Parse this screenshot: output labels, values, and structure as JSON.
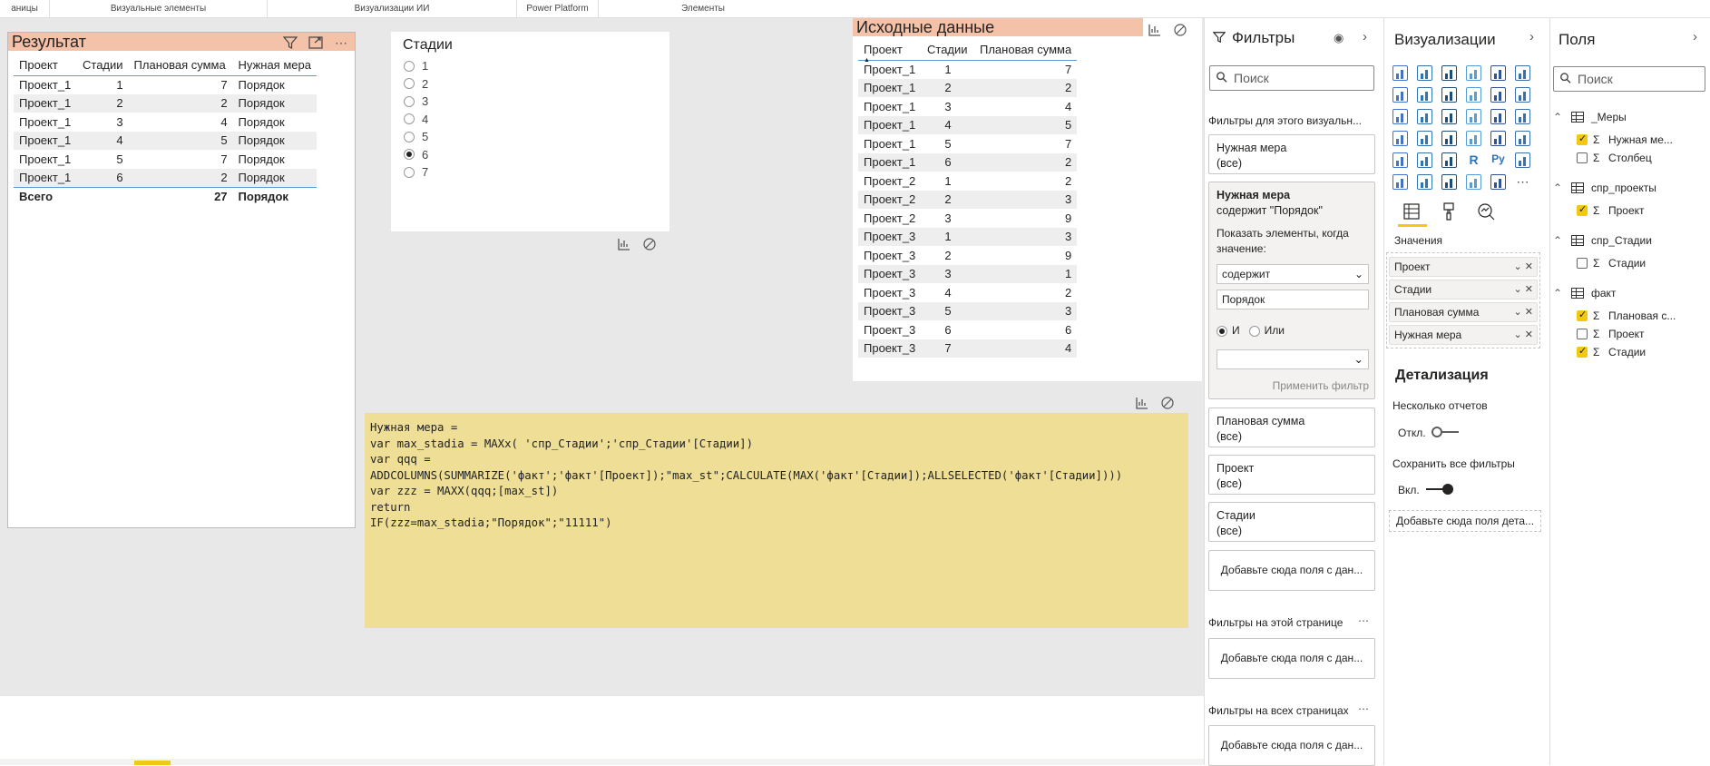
{
  "ribbon": {
    "sections": [
      "аницы",
      "Визуальные элементы",
      "Визуализации ИИ",
      "Power Platform",
      "Элементы"
    ]
  },
  "result_table": {
    "title": "Результат",
    "headers": [
      "Проект",
      "Стадии",
      "Плановая сумма",
      "Нужная мера"
    ],
    "rows": [
      [
        "Проект_1",
        "1",
        "7",
        "Порядок"
      ],
      [
        "Проект_1",
        "2",
        "2",
        "Порядок"
      ],
      [
        "Проект_1",
        "3",
        "4",
        "Порядок"
      ],
      [
        "Проект_1",
        "4",
        "5",
        "Порядок"
      ],
      [
        "Проект_1",
        "5",
        "7",
        "Порядок"
      ],
      [
        "Проект_1",
        "6",
        "2",
        "Порядок"
      ]
    ],
    "total": [
      "Всего",
      "",
      "27",
      "Порядок"
    ]
  },
  "slicer": {
    "title": "Стадии",
    "options": [
      "1",
      "2",
      "3",
      "4",
      "5",
      "6",
      "7"
    ],
    "selected": "6"
  },
  "source_table": {
    "title": "Исходные данные",
    "headers": [
      "Проект",
      "Стадии",
      "Плановая сумма"
    ],
    "rows": [
      [
        "Проект_1",
        "1",
        "7"
      ],
      [
        "Проект_1",
        "2",
        "2"
      ],
      [
        "Проект_1",
        "3",
        "4"
      ],
      [
        "Проект_1",
        "4",
        "5"
      ],
      [
        "Проект_1",
        "5",
        "7"
      ],
      [
        "Проект_1",
        "6",
        "2"
      ],
      [
        "Проект_2",
        "1",
        "2"
      ],
      [
        "Проект_2",
        "2",
        "3"
      ],
      [
        "Проект_2",
        "3",
        "9"
      ],
      [
        "Проект_3",
        "1",
        "3"
      ],
      [
        "Проект_3",
        "2",
        "9"
      ],
      [
        "Проект_3",
        "3",
        "1"
      ],
      [
        "Проект_3",
        "4",
        "2"
      ],
      [
        "Проект_3",
        "5",
        "3"
      ],
      [
        "Проект_3",
        "6",
        "6"
      ],
      [
        "Проект_3",
        "7",
        "4"
      ]
    ]
  },
  "code_text": "Нужная мера =\nvar max_stadia = MAXx( 'спр_Стадии';'спр_Стадии'[Стадии])\nvar qqq =\nADDCOLUMNS(SUMMARIZE('факт';'факт'[Проект]);\"max_st\";CALCULATE(MAX('факт'[Стадии]);ALLSELECTED('факт'[Стадии])))\nvar zzz = MAXX(qqq;[max_st])\nreturn\nIF(zzz=max_stadia;\"Порядок\";\"11111\")",
  "filters": {
    "title": "Фильтры",
    "search_placeholder": "Поиск",
    "visual_section": "Фильтры для этого визуальн...",
    "card1": {
      "name": "Нужная мера",
      "value": "(все)"
    },
    "expanded": {
      "name": "Нужная мера",
      "subtitle": "содержит \"Порядок\"",
      "show_label": "Показать элементы, когда значение:",
      "condition": "содержит",
      "value": "Порядок",
      "and_label": "И",
      "or_label": "Или",
      "apply": "Применить фильтр"
    },
    "card2": {
      "name": "Плановая сумма",
      "value": "(все)"
    },
    "card3": {
      "name": "Проект",
      "value": "(все)"
    },
    "card4": {
      "name": "Стадии",
      "value": "(все)"
    },
    "add_field": "Добавьте сюда поля с дан...",
    "page_section": "Фильтры на этой странице",
    "page_add": "Добавьте сюда поля с дан...",
    "all_section": "Фильтры на всех страницах",
    "all_add": "Добавьте сюда поля с дан..."
  },
  "visualizations": {
    "title": "Визуализации",
    "values_label": "Значения",
    "wells": [
      "Проект",
      "Стадии",
      "Плановая сумма",
      "Нужная мера"
    ],
    "drill_title": "Детализация",
    "cross_report": "Несколько отчетов",
    "cross_state": "Откл.",
    "keep_filters": "Сохранить все фильтры",
    "keep_state": "Вкл.",
    "drill_add": "Добавьте сюда поля дета..."
  },
  "fields": {
    "title": "Поля",
    "search_placeholder": "Поиск",
    "tables": [
      {
        "name": "_Меры",
        "items": [
          {
            "label": "Нужная ме...",
            "checked": true
          },
          {
            "label": "Столбец",
            "checked": false
          }
        ]
      },
      {
        "name": "спр_проекты",
        "items": [
          {
            "label": "Проект",
            "checked": true
          }
        ]
      },
      {
        "name": "спр_Стадии",
        "items": [
          {
            "label": "Стадии",
            "checked": false
          }
        ]
      },
      {
        "name": "факт",
        "items": [
          {
            "label": "Плановая с...",
            "checked": true
          },
          {
            "label": "Проект",
            "checked": false
          },
          {
            "label": "Стадии",
            "checked": true
          }
        ]
      }
    ]
  }
}
